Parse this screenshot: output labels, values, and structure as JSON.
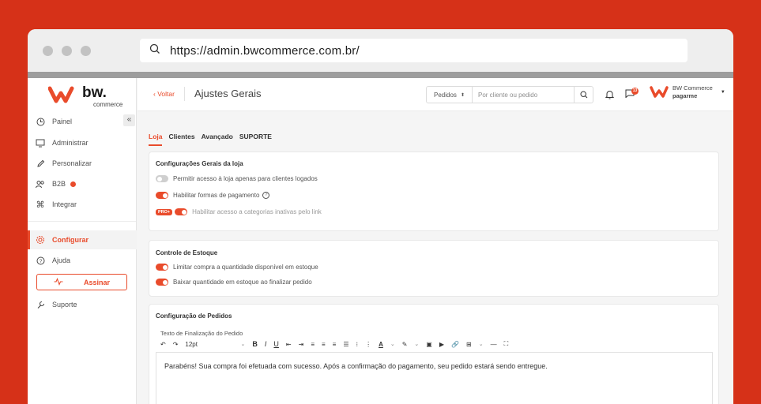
{
  "browser": {
    "url": "https://admin.bwcommerce.com.br/"
  },
  "brand": {
    "name": "bw.",
    "sub": "commerce",
    "accent": "#e94b2b"
  },
  "sidebar": {
    "collapse_label": "«",
    "items": [
      {
        "label": "Painel",
        "icon": "clock-icon"
      },
      {
        "label": "Administrar",
        "icon": "monitor-icon"
      },
      {
        "label": "Personalizar",
        "icon": "pencil-icon"
      },
      {
        "label": "B2B",
        "icon": "users-icon"
      },
      {
        "label": "Integrar",
        "icon": "command-icon"
      },
      {
        "label": "Configurar",
        "icon": "gear-icon"
      },
      {
        "label": "Ajuda",
        "icon": "help-icon"
      },
      {
        "label": "Suporte",
        "icon": "wrench-icon"
      }
    ],
    "assinar_label": "Assinar"
  },
  "topbar": {
    "back_label": "‹ Voltar",
    "title": "Ajustes Gerais",
    "search_select": "Pedidos",
    "search_placeholder": "Por cliente ou pedido",
    "notification_count": "13",
    "user_name": "BW Commerce",
    "user_company": "pagarme"
  },
  "tabs": [
    "Loja",
    "Clientes",
    "Avançado",
    "SUPORTE"
  ],
  "general": {
    "title": "Configurações Gerais da loja",
    "options": [
      {
        "label": "Permitir acesso à loja apenas para clientes logados",
        "on": false
      },
      {
        "label": "Habilitar formas de pagamento",
        "on": true
      },
      {
        "label": "Habilitar acesso a categorias inativas pelo link",
        "on": true,
        "badge": "PRO+"
      }
    ]
  },
  "stock": {
    "title": "Controle de Estoque",
    "options": [
      {
        "label": "Limitar compra a quantidade disponível em estoque",
        "on": true
      },
      {
        "label": "Baixar quantidade em estoque ao finalizar pedido",
        "on": true
      }
    ]
  },
  "orders": {
    "title": "Configuração de Pedidos",
    "editor_label": "Texto de Finalização do Pedido",
    "font_size": "12pt",
    "editor_text": "Parabéns! Sua compra foi efetuada com sucesso. Após a confirmação do pagamento, seu pedido estará sendo entregue."
  }
}
